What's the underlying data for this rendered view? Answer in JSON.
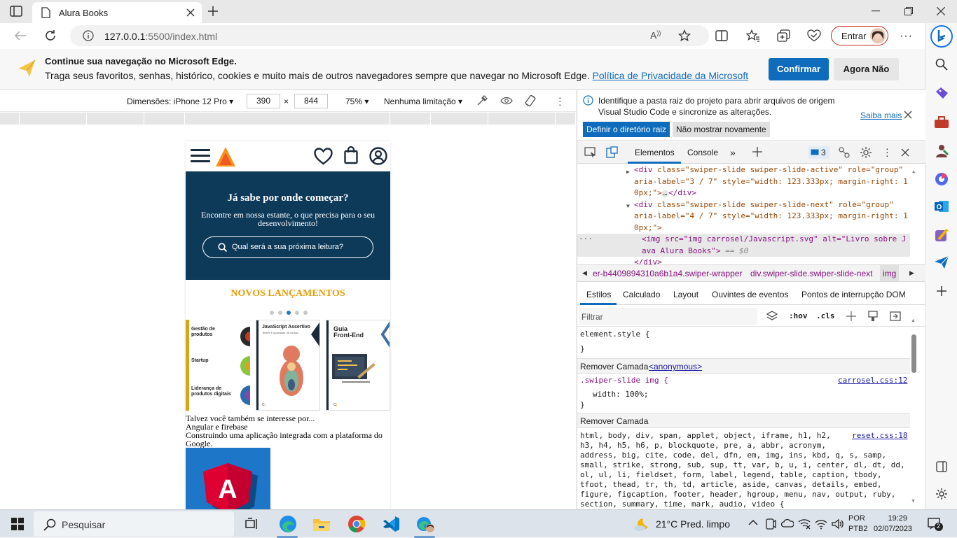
{
  "browser": {
    "tab_title": "Alura Books",
    "url_host": "127.0.0.1",
    "url_path": ":5500/index.html",
    "signin_label": "Entrar"
  },
  "infobar": {
    "title": "Continue sua navegação no Microsoft Edge.",
    "text": "Traga seus favoritos, senhas, histórico, cookies e muito mais de outros navegadores sempre que navegar no Microsoft Edge.",
    "link": "Política de Privacidade da Microsoft",
    "confirm": "Confirmar",
    "later": "Agora Não"
  },
  "device_toolbar": {
    "dimensions": "Dimensões: iPhone 12 Pro",
    "width": "390",
    "times": "×",
    "height": "844",
    "zoom": "75%",
    "throttle": "Nenhuma limitação"
  },
  "page": {
    "hero_title": "Já sabe por onde começar?",
    "hero_subtitle": "Encontre em nossa estante, o que precisa para o seu desenvolvimento!",
    "search_placeholder": "Qual será a sua próxima leitura?",
    "section_title": "NOVOS LANÇAMENTOS",
    "books": [
      {
        "l1": "Gestão de",
        "l2": "produtos",
        "l3": "Startup",
        "l4": "Liderança de",
        "l5": "produtos digitais"
      },
      {
        "l1": "JavaScript Assertivo",
        "l2": "Testes e qualidade de código"
      },
      {
        "l1": "Guia",
        "l2": "Front-End"
      }
    ],
    "interest_text": "Talvez você também se interesse por...",
    "book_title": "Angular e firebase",
    "book_desc": "Construindo uma aplicação integrada com a plataforma do Google.",
    "angular_letter": "A"
  },
  "devtools": {
    "notice_text1": "Identifique a pasta raiz do projeto para abrir arquivos de origem",
    "notice_text2": "Visual Studio Code e sincronize as alterações.",
    "notice_link": "Saiba mais",
    "notice_btn1": "Definir o diretório raiz",
    "notice_btn2": "Não mostrar novamente",
    "tab_elements": "Elementos",
    "tab_console": "Console",
    "issues_count": "3",
    "dom": {
      "l1_tag": "<div",
      "l1_attrs": " class=\"swiper-slide swiper-slide-active\" role=\"group\"",
      "l2": "aria-label=\"3 / 7\" style=\"width: 123.333px; margin-right: 1",
      "l3": "0px;\">",
      "l3_end": "</div>",
      "l4_attrs": " class=\"swiper-slide swiper-slide-next\" role=\"group\"",
      "l5": "aria-label=\"4 / 7\" style=\"width: 123.333px; margin-right: 1",
      "l6": "0px;\">",
      "l7": "<img src=\"img carrosel/Javascript.svg\" alt=\"Livro sobre J",
      "l8": "ava Alura Books\">",
      "l8_eq": " == $0",
      "l9": "</div>"
    },
    "crumbs": [
      "er-b4409894310a6b1a4.swiper-wrapper",
      "div.swiper-slide.swiper-slide-next",
      "img"
    ],
    "style_tabs": [
      "Estilos",
      "Calculado",
      "Layout",
      "Ouvintes de eventos",
      "Pontos de interrupção DOM"
    ],
    "filter_placeholder": "Filtrar",
    "hov": ":hov",
    "cls": ".cls",
    "styles": {
      "element_style": "element.style {",
      "close": "}",
      "layer1": "Remover Camada",
      "layer1_anon": "<anonymous>",
      "rule1_sel": ".swiper-slide img {",
      "rule1_src": "carrosel.css:12",
      "rule1_prop": "width: 100%;",
      "layer2": "Remover Camada",
      "rule2_src": "reset.css:18",
      "rule2_lines": [
        "html, body, div, span, applet, object, iframe, h1, h2,",
        "h3, h4, h5, h6, p, blockquote, pre, a, abbr, acronym,",
        "address, big, cite, code, del, dfn, em, img, ins, kbd, q, s, samp,",
        "small, strike, strong, sub, sup, tt, var, b, u, i, center, dl, dt, dd,",
        "ol, ul, li, fieldset, form, label, legend, table, caption, tbody,",
        "tfoot, thead, tr, th, td, article, aside, canvas, details, embed,",
        "figure, figcaption, footer, header, hgroup, menu, nav, output, ruby,",
        "section, summary, time, mark, audio, video {"
      ]
    }
  },
  "taskbar": {
    "search": "Pesquisar",
    "weather": "21°C  Pred. limpo",
    "lang1": "POR",
    "lang2": "PTB2",
    "time": "19:29",
    "date": "02/07/2023",
    "notif": "2"
  }
}
